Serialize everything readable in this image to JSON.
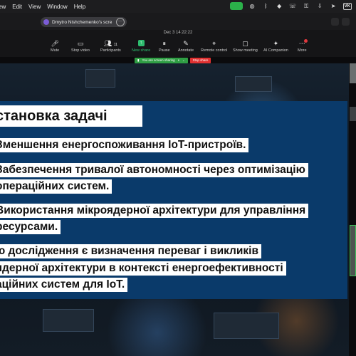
{
  "menubar": {
    "items": [
      "ew",
      "Edit",
      "View",
      "Window",
      "Help"
    ],
    "status_icons": [
      "camera-icon",
      "messenger-icon",
      "bluetooth-icon",
      "diamond-icon",
      "viber-icon",
      "key-icon",
      "download-icon",
      "telegram-icon",
      "vk-icon"
    ],
    "vk_label": "VK"
  },
  "zoom_tab": {
    "title": "Dmytro Nishchemenko's scre",
    "more": "···"
  },
  "toolbar": {
    "datetime": "Dec 3  14:22:22",
    "tools": [
      {
        "label": "Mute",
        "icon": "microphone-icon",
        "glyph": "🎤"
      },
      {
        "label": "Stop video",
        "icon": "video-camera-icon",
        "glyph": "▭"
      },
      {
        "label": "Participants",
        "icon": "participants-icon",
        "glyph": "👥",
        "count": "11"
      },
      {
        "label": "New share",
        "icon": "share-screen-icon",
        "glyph": "↑"
      },
      {
        "label": "Pause",
        "icon": "pause-icon",
        "glyph": "⏸"
      },
      {
        "label": "Annotate",
        "icon": "annotate-icon",
        "glyph": "✎"
      },
      {
        "label": "Remote control",
        "icon": "remote-control-icon",
        "glyph": "⌖"
      },
      {
        "label": "Show meeting",
        "icon": "show-meeting-icon",
        "glyph": "▢"
      },
      {
        "label": "AI Companion",
        "icon": "ai-companion-icon",
        "glyph": "✦"
      },
      {
        "label": "More",
        "icon": "more-icon",
        "glyph": "⋯"
      }
    ],
    "sharing_status": "You are screen sharing",
    "stop_share": "Stop share"
  },
  "colors": {
    "accent_green": "#2dbd6e",
    "stop_red": "#e03131",
    "slide_blue": "#0a3a6a"
  },
  "slide": {
    "title": "становка задачі",
    "lines": [
      "Зменшення енергоспоживання IoT-пристроїв.",
      "Забезпечення тривалої автономності через оптимізацію",
      "операційних систем.",
      "Використання мікроядерної архітектури для управління",
      "ресурсами.",
      "ю дослідження є визначення переваг і викликів",
      "ядерної архітектури в контексті енергоефективності",
      "аційних систем для IoT."
    ]
  }
}
